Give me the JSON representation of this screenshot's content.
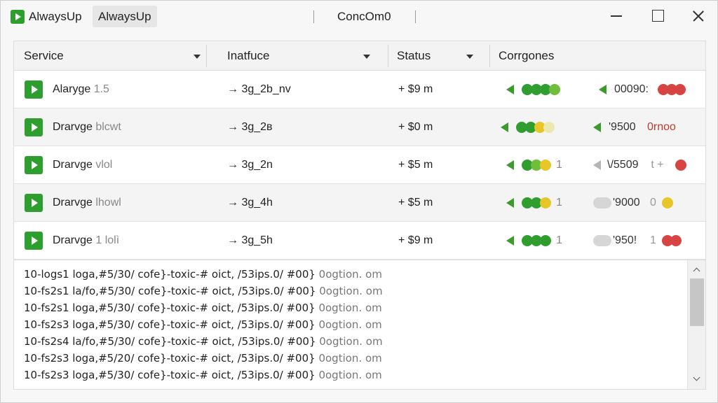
{
  "titlebar": {
    "app_name": "AlwaysUp",
    "tab_label": "AlwaysUp",
    "center_text": "ConcOm0",
    "icons": {
      "app": "play-icon",
      "min": "minimize-icon",
      "max": "maximize-icon",
      "close": "close-icon"
    }
  },
  "table": {
    "columns": [
      {
        "label": "Service",
        "has_dropdown": true
      },
      {
        "label": "Inatfuce",
        "has_dropdown": true
      },
      {
        "label": "Status",
        "has_dropdown": true
      },
      {
        "label": "Corrgones",
        "has_dropdown": false
      }
    ],
    "rows": [
      {
        "name_main": "Alaryge",
        "name_sub": "1.5",
        "interface": "→ 3g_2b_nv",
        "status": "+ $9 m",
        "dots": [
          "#2f9e2f",
          "#2f9e2f",
          "#2f9e2f",
          "#6fbf3c"
        ],
        "dots_suffix": "",
        "right_text": "00090:",
        "right_dots": [
          "#d64541",
          "#d64541",
          "#d64541"
        ]
      },
      {
        "name_main": "Drarvge",
        "name_sub": "blcwt",
        "interface": "→ 3g_2в",
        "status": "+ $0 m",
        "dots": [
          "#2f9e2f",
          "#2f9e2f",
          "#e6c629",
          "#ece9b0"
        ],
        "dots_suffix": "",
        "right_text": "'9500",
        "right_red": "0rnoo"
      },
      {
        "name_main": "Drarvge",
        "name_sub": "vlol",
        "interface": "→ 3g_2n",
        "status": "+ $5 m",
        "dots": [
          "#2f9e2f",
          "#6fbf3c",
          "#e6c629"
        ],
        "dots_suffix": "1",
        "right_text": "\\/5509",
        "right_muted": "t +",
        "right_dots": [
          "#d64541"
        ]
      },
      {
        "name_main": "Drarvge",
        "name_sub": "lhowl",
        "interface": "→ 3g_4h",
        "status": "+ $5 m",
        "dots": [
          "#2f9e2f",
          "#2f9e2f",
          "#e6c629"
        ],
        "dots_suffix": "1",
        "right_text": "'9000",
        "right_muted": "0",
        "right_dots": [
          "#e6c629"
        ]
      },
      {
        "name_main": "Drarvge",
        "name_sub": "1 lolì",
        "interface": "→ 3g_5h",
        "status": "+ $9 m",
        "dots": [
          "#2f9e2f",
          "#2f9e2f",
          "#2f9e2f"
        ],
        "dots_suffix": "1",
        "right_text": "'950!",
        "right_muted": "1",
        "right_dots": [
          "#d64541",
          "#d64541"
        ]
      }
    ]
  },
  "log": {
    "lines": [
      {
        "text": "10-logs1 loga,#5/30/ cofe}-toxic-# oict, /53ips.0/ #00}",
        "tail": "0ogtion. om"
      },
      {
        "text": "10-fs2s1 la/fo,#5/30/ cofe}-toxic-# oict, /53ips.0/ #00}",
        "tail": "0ogtion. om"
      },
      {
        "text": "10-fs2s1 loga,#5/30/ cofe}-toxic-# oict, /53ips.0/ #00}",
        "tail": "0ogtion. om"
      },
      {
        "text": "10-fs2s3 loga,#5/30/ cofe}-toxic-# oict, /53ips.0/ #00}",
        "tail": "0ogtion. om"
      },
      {
        "text": "10-fs2s4 la/fo,#5/30/ cofe}-toxic-# oict, /53ips.0/ #00}",
        "tail": "0ogtion. om"
      },
      {
        "text": "10-fs2s3 loga,#5/20/ cofe}-toxic-# oict, /53ips.0/ #00}",
        "tail": "0ogtion. om"
      },
      {
        "text": "10-fs2s3 loga,#5/30/ cofe}-toxic-# oict, /53ips.0/ #00}",
        "tail": "0ogtion. om"
      }
    ]
  }
}
